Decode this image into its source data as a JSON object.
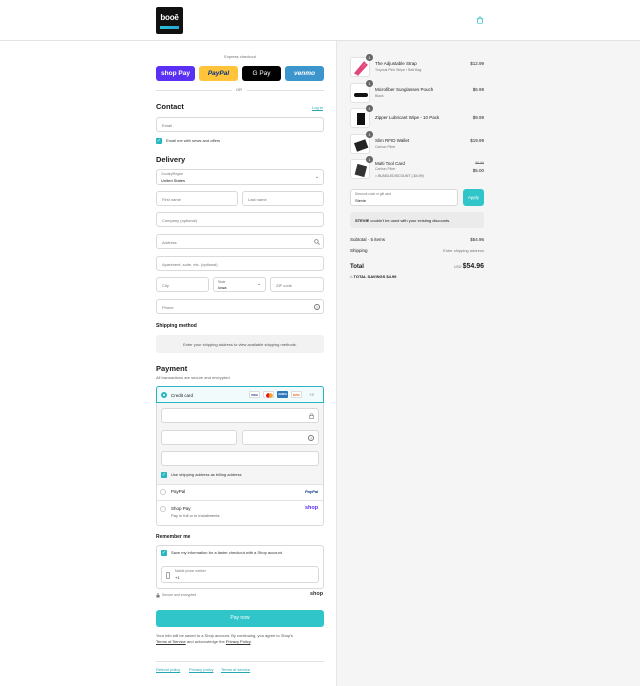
{
  "header": {
    "logo_text": "booē",
    "cart_icon": "shopping-bag-icon"
  },
  "express": {
    "label": "Express checkout",
    "buttons": [
      {
        "label": "shop Pay",
        "bg": "#5a31f4",
        "fg": "#ffffff"
      },
      {
        "label": "PayPal",
        "bg": "#ffc439",
        "fg": "#003087"
      },
      {
        "label": "G Pay",
        "bg": "#000000",
        "fg": "#ffffff"
      },
      {
        "label": "venmo",
        "bg": "#3d95ce",
        "fg": "#ffffff"
      }
    ],
    "or": "OR"
  },
  "contact": {
    "heading": "Contact",
    "login_link": "Log in",
    "email_placeholder": "Email",
    "news_label": "Email me with news and offers"
  },
  "delivery": {
    "heading": "Delivery",
    "country_label": "Country/Region",
    "country_value": "United States",
    "first_name": "First name",
    "last_name": "Last name",
    "company": "Company (optional)",
    "address": "Address",
    "apartment": "Apartment, suite, etc. (optional)",
    "city": "City",
    "state_label": "State",
    "state_value": "Iowa",
    "zip": "ZIP code",
    "phone": "Phone"
  },
  "shipping_method": {
    "heading": "Shipping method",
    "note": "Enter your shipping address to view available shipping methods."
  },
  "payment": {
    "heading": "Payment",
    "subtitle": "All transactions are secure and encrypted.",
    "credit_card": "Credit card",
    "card_brands": [
      "VISA",
      "MC",
      "AMEX",
      "DISC"
    ],
    "more_cards": "+3",
    "billing_label": "Use shipping address as billing address",
    "paypal": "PayPal",
    "paypal_logo": "PayPal",
    "shop_pay": "Shop Pay",
    "shop_pay_sub": "Pay in full or in installments",
    "shop_logo": "shop"
  },
  "remember": {
    "heading": "Remember me",
    "save_label": "Save my information for a faster checkout with a Shop account",
    "mobile_label": "Mobile phone number",
    "mobile_value": "+1",
    "secure_label": "Secure and encrypted",
    "shop_logo": "shop"
  },
  "pay_now": "Pay now",
  "disclaimer": {
    "text1": "Your info will be saved to a Shop account. By continuing, you agree to Shop's",
    "terms": "Terms of Service",
    "text2": " and acknowledge the ",
    "privacy": "Privacy Policy",
    "end": "."
  },
  "footer_links": [
    "Refund policy",
    "Privacy policy",
    "Terms of service"
  ],
  "order": {
    "items": [
      {
        "qty": "1",
        "title": "The Adjustable Strap",
        "sub": "Tropical Pink Stripe / Belt Bag",
        "price": "$12.99",
        "old": "",
        "discount": ""
      },
      {
        "qty": "1",
        "title": "Microfiber Sunglasses Pouch",
        "sub": "Black",
        "price": "$6.99",
        "old": "",
        "discount": ""
      },
      {
        "qty": "1",
        "title": "Zipper Lubricant Wipe - 10 Pack",
        "sub": "",
        "price": "$9.99",
        "old": "",
        "discount": ""
      },
      {
        "qty": "1",
        "title": "Slim RFID Wallet",
        "sub": "Carbon Fiber",
        "price": "$19.99",
        "old": "",
        "discount": ""
      },
      {
        "qty": "1",
        "title": "Multi Tool Card",
        "sub": "Carbon Fiber",
        "price": "$5.00",
        "old": "$9.99",
        "discount": "BUNDLEDISCOUNT (-$4.99)"
      }
    ],
    "discount_label": "Discount code or gift card",
    "discount_value": "Stevie",
    "apply": "Apply",
    "warning_code": "STEVIE",
    "warning_text": " couldn't be used with your existing discounts.",
    "subtotal_label": "Subtotal · 5 items",
    "subtotal": "$54.96",
    "shipping_label": "Shipping",
    "shipping_value": "Enter shipping address",
    "total_label": "Total",
    "currency": "USD",
    "total": "$54.96",
    "savings_label": "TOTAL SAVINGS",
    "savings": "$4.99"
  }
}
